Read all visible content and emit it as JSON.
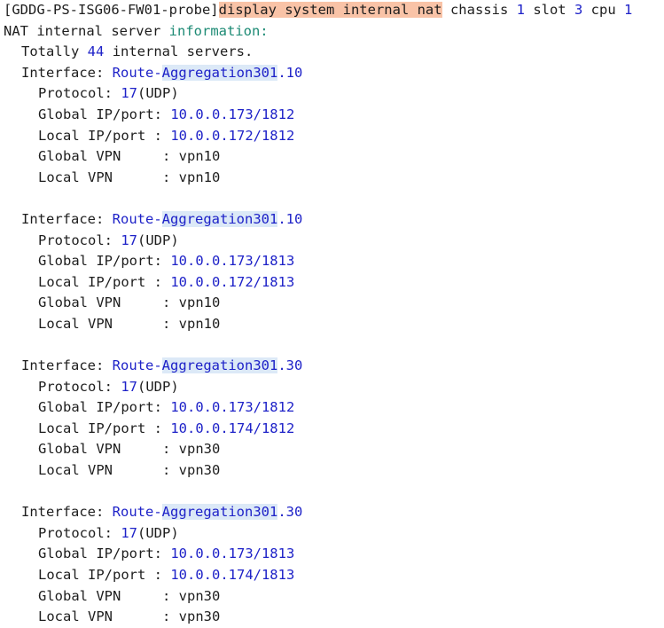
{
  "prompt": "[GDDG-PS-ISG06-FW01-probe]",
  "command": {
    "highlighted": "display system internal nat",
    "chassis_label": "chassis",
    "chassis_value": "1",
    "slot_label": "slot",
    "slot_value": "3",
    "cpu_label": "cpu",
    "cpu_value": "1"
  },
  "header": {
    "prefix": "NAT internal server",
    "suffix": "information:"
  },
  "summary": {
    "prefix": "Totally",
    "count": "44",
    "suffix": "internal servers."
  },
  "labels": {
    "interface": "Interface:",
    "protocol": "Protocol:",
    "global_ip_port": "Global IP/port:",
    "local_ip_port": "Local IP/port :",
    "global_vpn": "Global VPN     :",
    "local_vpn": "Local VPN      :"
  },
  "entries": [
    {
      "iface_prefix": "Route-",
      "iface_hl": "Aggregation301",
      "iface_suffix": ".10",
      "protocol_num": "17",
      "protocol_name": "(UDP)",
      "global_ip": "10.0.0.173/1812",
      "local_ip": "10.0.0.172/1812",
      "global_vpn": "vpn10",
      "local_vpn": "vpn10"
    },
    {
      "iface_prefix": "Route-",
      "iface_hl": "Aggregation301",
      "iface_suffix": ".10",
      "protocol_num": "17",
      "protocol_name": "(UDP)",
      "global_ip": "10.0.0.173/1813",
      "local_ip": "10.0.0.172/1813",
      "global_vpn": "vpn10",
      "local_vpn": "vpn10"
    },
    {
      "iface_prefix": "Route-",
      "iface_hl": "Aggregation301",
      "iface_suffix": ".30",
      "protocol_num": "17",
      "protocol_name": "(UDP)",
      "global_ip": "10.0.0.173/1812",
      "local_ip": "10.0.0.174/1812",
      "global_vpn": "vpn30",
      "local_vpn": "vpn30"
    },
    {
      "iface_prefix": "Route-",
      "iface_hl": "Aggregation301",
      "iface_suffix": ".30",
      "protocol_num": "17",
      "protocol_name": "(UDP)",
      "global_ip": "10.0.0.173/1813",
      "local_ip": "10.0.0.174/1813",
      "global_vpn": "vpn30",
      "local_vpn": "vpn30"
    }
  ]
}
